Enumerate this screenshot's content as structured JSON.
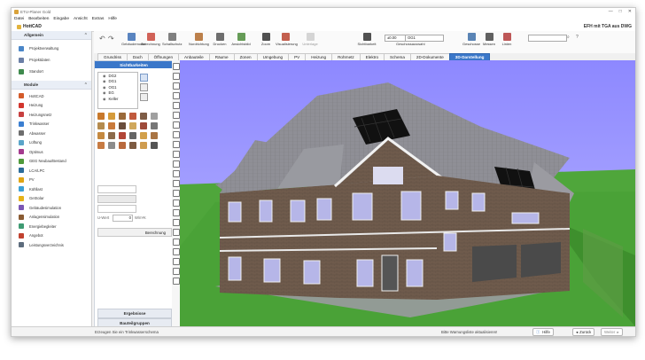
{
  "window": {
    "title": "ETU-Planer Gold",
    "controls": [
      "—",
      "□",
      "✕"
    ]
  },
  "menu": [
    "Datei",
    "Bearbeiten",
    "Eingabe",
    "Ansicht",
    "Extras",
    "Hilfe"
  ],
  "document": {
    "name": "HottCAD",
    "right_label": "EFH mit TGA aus DWG"
  },
  "left_panel": {
    "allgemein_title": "Allgemein",
    "allgemein_items": [
      {
        "label": "Projektverwaltung",
        "icon": "folder-icon",
        "color": "#4a86c8"
      },
      {
        "label": "Projektdaten",
        "icon": "data-icon",
        "color": "#6b7fa6"
      },
      {
        "label": "Standort",
        "icon": "location-icon",
        "color": "#3f8a4d"
      }
    ],
    "module_title": "Module",
    "module_items": [
      {
        "label": "HottCAD",
        "icon": "house-icon",
        "color": "#d45b2a"
      },
      {
        "label": "Heizung",
        "icon": "heating-icon",
        "color": "#d2352d"
      },
      {
        "label": "Heizungsnetz",
        "icon": "network-icon",
        "color": "#c74040"
      },
      {
        "label": "Trinkwasser",
        "icon": "water-icon",
        "color": "#3b7fd1"
      },
      {
        "label": "Abwasser",
        "icon": "drain-icon",
        "color": "#6d6d6d"
      },
      {
        "label": "Lüftung",
        "icon": "ventilation-icon",
        "color": "#5aa5c9"
      },
      {
        "label": "Optimus",
        "icon": "optimus-icon",
        "color": "#a43a8e"
      },
      {
        "label": "GEG Neubau/Bestand",
        "icon": "energy-icon",
        "color": "#4f9a3a"
      },
      {
        "label": "LCA/LPC",
        "icon": "lca-icon",
        "color": "#2b6c9a"
      },
      {
        "label": "PV",
        "icon": "pv-icon",
        "color": "#e0a514"
      },
      {
        "label": "Kühllast",
        "icon": "cooling-icon",
        "color": "#3aa0d6"
      },
      {
        "label": "GetSolar",
        "icon": "solar-icon",
        "color": "#e6b319"
      },
      {
        "label": "Gebäudesimulation",
        "icon": "simulation-icon",
        "color": "#7b56b4"
      },
      {
        "label": "Anlagensimulation",
        "icon": "plant-icon",
        "color": "#8a5b32"
      },
      {
        "label": "Energiebegleiter",
        "icon": "companion-icon",
        "color": "#3f9b73"
      },
      {
        "label": "Angebot",
        "icon": "offer-icon",
        "color": "#c1412f"
      },
      {
        "label": "Leistungsverzeichnis",
        "icon": "list-icon",
        "color": "#5d6c7d"
      }
    ]
  },
  "ribbon": {
    "buttons": [
      {
        "label": "Gebäudemodul",
        "icon": "building-icon",
        "color": "#3c6fb5"
      },
      {
        "label": "Berechnung",
        "icon": "calc-icon",
        "color": "#c9473b"
      },
      {
        "label": "Schallschutz",
        "icon": "sound-icon",
        "color": "#6a6a6a"
      },
      {
        "label": "Nordrichtung",
        "icon": "north-icon",
        "color": "#b06a2b"
      },
      {
        "label": "Drucken",
        "icon": "printer-icon",
        "color": "#555555"
      },
      {
        "label": "Ansichtsbild",
        "icon": "image-icon",
        "color": "#4b8b3a"
      },
      {
        "label": "Zoom",
        "icon": "zoom-icon",
        "color": "#333333"
      },
      {
        "label": "Visualisierung",
        "icon": "visual-icon",
        "color": "#b9432f"
      },
      {
        "label": "Unterlage",
        "icon": "layer-icon",
        "color": "#9d9d9d"
      },
      {
        "label": "Sichtbarkeit",
        "icon": "eye-icon",
        "color": "#333333"
      },
      {
        "label": "Geschosse",
        "icon": "floors-icon",
        "color": "#3d6ea8"
      },
      {
        "label": "Messen",
        "icon": "measure-icon",
        "color": "#444444"
      },
      {
        "label": "Linien",
        "icon": "lines-icon",
        "color": "#b33b3b"
      }
    ],
    "height_value": "±0.00",
    "storey_value": "OG1",
    "storey_select_label": "Geschossauswahl",
    "search_placeholder": ""
  },
  "tabs": [
    "Grundriss",
    "Dach",
    "Öffnungen",
    "Anbauteile",
    "Räume",
    "Zonen",
    "Umgebung",
    "PV",
    "Heizung",
    "Rohrnetz",
    "Elektro",
    "Schema",
    "2D-Dokumente",
    "3D-Darstellung"
  ],
  "active_tab": "3D-Darstellung",
  "sidebar": {
    "header": "Sichtbarkeiten",
    "storeys": [
      "DG2",
      "DG1",
      "OG1",
      "EG",
      "Keller"
    ],
    "umwert_label": "U-Wert",
    "umwert_value": "0",
    "umwert_unit": "W/m²K",
    "berechnung_label": "Berechnung",
    "ergebnisse_label": "Ergebnisse",
    "bauteilgruppen_label": "Bauteilgruppen"
  },
  "status": {
    "left_text": "Erzeugen Sie ein Trinkwasserschema",
    "right_text": "Bitte Warnungsliste aktualisieren!",
    "help": "Hilfe",
    "back": "Zurück",
    "next": "Weiter"
  },
  "colors": {
    "accent": "#3a77c9",
    "sky_top": "#8d88ff",
    "sky_bottom": "#b6b3ff",
    "lawn": "#4ea53a",
    "brick": "#6e5a4b",
    "roof": "#8d8d93"
  }
}
